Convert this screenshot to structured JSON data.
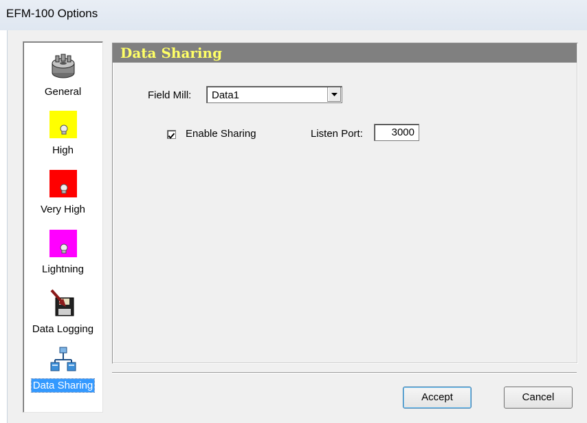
{
  "window": {
    "title": "EFM-100 Options"
  },
  "sidebar": {
    "items": [
      {
        "label": "General",
        "icon": "gear-icon",
        "selected": false
      },
      {
        "label": "High",
        "icon": "alarm-yellow-icon",
        "color": "#ffff00",
        "selected": false
      },
      {
        "label": "Very High",
        "icon": "alarm-red-icon",
        "color": "#ff0000",
        "selected": false
      },
      {
        "label": "Lightning",
        "icon": "alarm-magenta-icon",
        "color": "#ff00ff",
        "selected": false
      },
      {
        "label": "Data Logging",
        "icon": "floppy-disk-icon",
        "selected": false
      },
      {
        "label": "Data Sharing",
        "icon": "network-icon",
        "selected": true
      }
    ]
  },
  "panel": {
    "title": "Data Sharing",
    "title_color": "#ffff66",
    "field_mill": {
      "label": "Field Mill:",
      "value": "Data1"
    },
    "enable_sharing": {
      "label": "Enable Sharing",
      "checked": true
    },
    "listen_port": {
      "label": "Listen Port:",
      "value": "3000"
    }
  },
  "buttons": {
    "accept": "Accept",
    "cancel": "Cancel"
  }
}
